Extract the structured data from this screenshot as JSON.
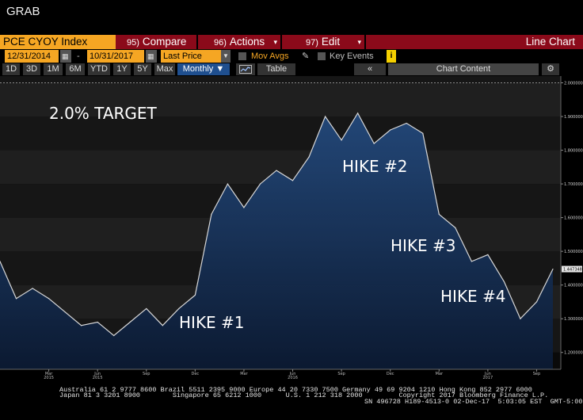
{
  "window": {
    "title": "GRAB"
  },
  "toolbar": {
    "security": "PCE CYOY Index",
    "compare": {
      "num": "95)",
      "label": "Compare"
    },
    "actions": {
      "num": "96)",
      "label": "Actions"
    },
    "edit": {
      "num": "97)",
      "label": "Edit"
    },
    "chart_type": "Line Chart",
    "start_date": "12/31/2014",
    "end_date": "10/31/2017",
    "field": "Last Price",
    "mov_avgs": "Mov Avgs",
    "key_events": "Key Events",
    "info": "i",
    "periods": [
      "1D",
      "3D",
      "1M",
      "6M",
      "YTD",
      "1Y",
      "5Y",
      "Max"
    ],
    "frequency": "Monthly",
    "table": "Table",
    "collapse": "«",
    "chart_content": "Chart Content",
    "settings_icon": "gear-icon"
  },
  "chart_data": {
    "type": "area",
    "ylim": [
      1.15,
      2.02
    ],
    "y_ticks": [
      1.2,
      1.3,
      1.4,
      1.5,
      1.6,
      1.7,
      1.8,
      1.9,
      2.0
    ],
    "y_tick_labels": [
      "1.200000",
      "1.300000",
      "1.400000",
      "1.500000",
      "1.600000",
      "1.700000",
      "1.800000",
      "1.900000",
      "2.000000"
    ],
    "x_tick_labels": [
      {
        "month": "Mar",
        "year": "2015"
      },
      {
        "month": "Jun",
        "year": "2015"
      },
      {
        "month": "Sep",
        "year": ""
      },
      {
        "month": "Dec",
        "year": ""
      },
      {
        "month": "Mar",
        "year": ""
      },
      {
        "month": "Jun",
        "year": "2016"
      },
      {
        "month": "Sep",
        "year": ""
      },
      {
        "month": "Dec",
        "year": ""
      },
      {
        "month": "Mar",
        "year": ""
      },
      {
        "month": "Jun",
        "year": "2017"
      },
      {
        "month": "Sep",
        "year": ""
      }
    ],
    "x": [
      "Dec 2014",
      "Jan 2015",
      "Feb 2015",
      "Mar 2015",
      "Apr 2015",
      "May 2015",
      "Jun 2015",
      "Jul 2015",
      "Aug 2015",
      "Sep 2015",
      "Oct 2015",
      "Nov 2015",
      "Dec 2015",
      "Jan 2016",
      "Feb 2016",
      "Mar 2016",
      "Apr 2016",
      "May 2016",
      "Jun 2016",
      "Jul 2016",
      "Aug 2016",
      "Sep 2016",
      "Oct 2016",
      "Nov 2016",
      "Dec 2016",
      "Jan 2017",
      "Feb 2017",
      "Mar 2017",
      "Apr 2017",
      "May 2017",
      "Jun 2017",
      "Jul 2017",
      "Aug 2017",
      "Sep 2017",
      "Oct 2017"
    ],
    "series": [
      {
        "values": [
          1.47,
          1.36,
          1.39,
          1.36,
          1.32,
          1.28,
          1.29,
          1.25,
          1.29,
          1.33,
          1.28,
          1.33,
          1.37,
          1.61,
          1.7,
          1.63,
          1.7,
          1.74,
          1.71,
          1.78,
          1.9,
          1.83,
          1.91,
          1.82,
          1.86,
          1.88,
          1.85,
          1.61,
          1.57,
          1.47,
          1.49,
          1.41,
          1.3,
          1.35,
          1.447348
        ],
        "color": "#1a3a66"
      }
    ],
    "last_value_label": "1.447348",
    "annotations": [
      "2.0% TARGET",
      "HIKE #1",
      "HIKE #2",
      "HIKE #3",
      "HIKE #4"
    ]
  },
  "footer": {
    "line1": "Australia 61 2 9777 8600 Brazil 5511 2395 9000 Europe 44 20 7330 7500 Germany 49 69 9204 1210 Hong Kong 852 2977 6000",
    "line2": "Japan 81 3 3201 8900        Singapore 65 6212 1000      U.S. 1 212 318 2000         Copyright 2017 Bloomberg Finance L.P.",
    "line3": "SN 496728 H189-4513-0 02-Dec-17  5:03:05 EST  GMT-5:00"
  }
}
